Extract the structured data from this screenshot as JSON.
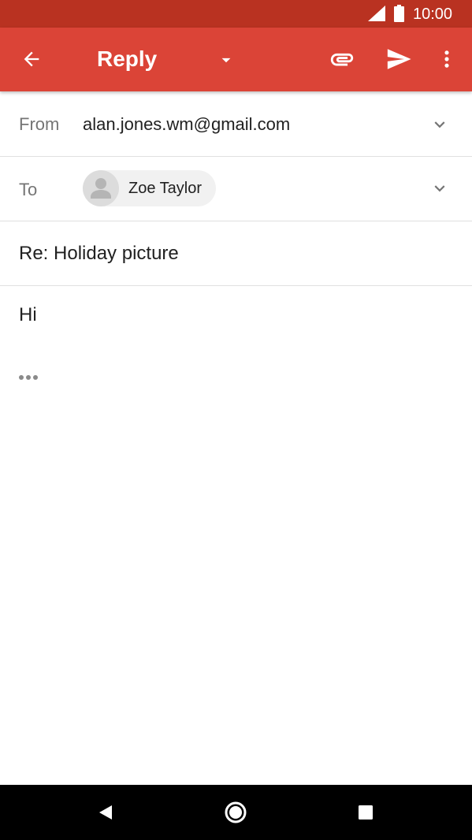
{
  "status_bar": {
    "time": "10:00",
    "icons": [
      "cellular-signal-icon",
      "battery-icon"
    ]
  },
  "app_bar": {
    "title": "Reply",
    "icons": [
      "back-arrow-icon",
      "dropdown-arrow-icon",
      "attachment-icon",
      "send-icon",
      "more-vert-icon"
    ]
  },
  "compose": {
    "from_label": "From",
    "from_value": "alan.jones.wm@gmail.com",
    "to_label": "To",
    "recipients": [
      {
        "name": "Zoe Taylor",
        "icon": "person-avatar-icon"
      }
    ],
    "subject": "Re: Holiday picture",
    "body": "Hi",
    "quoted_text_icon": "ellipsis-icon"
  },
  "nav_bar": {
    "icons": [
      "nav-back-icon",
      "nav-home-icon",
      "nav-recents-icon"
    ]
  },
  "colors": {
    "app_bar": "#db4437",
    "status_bar": "#b93221",
    "divider": "#e0e0e0",
    "label": "#757575",
    "text": "#212121"
  }
}
